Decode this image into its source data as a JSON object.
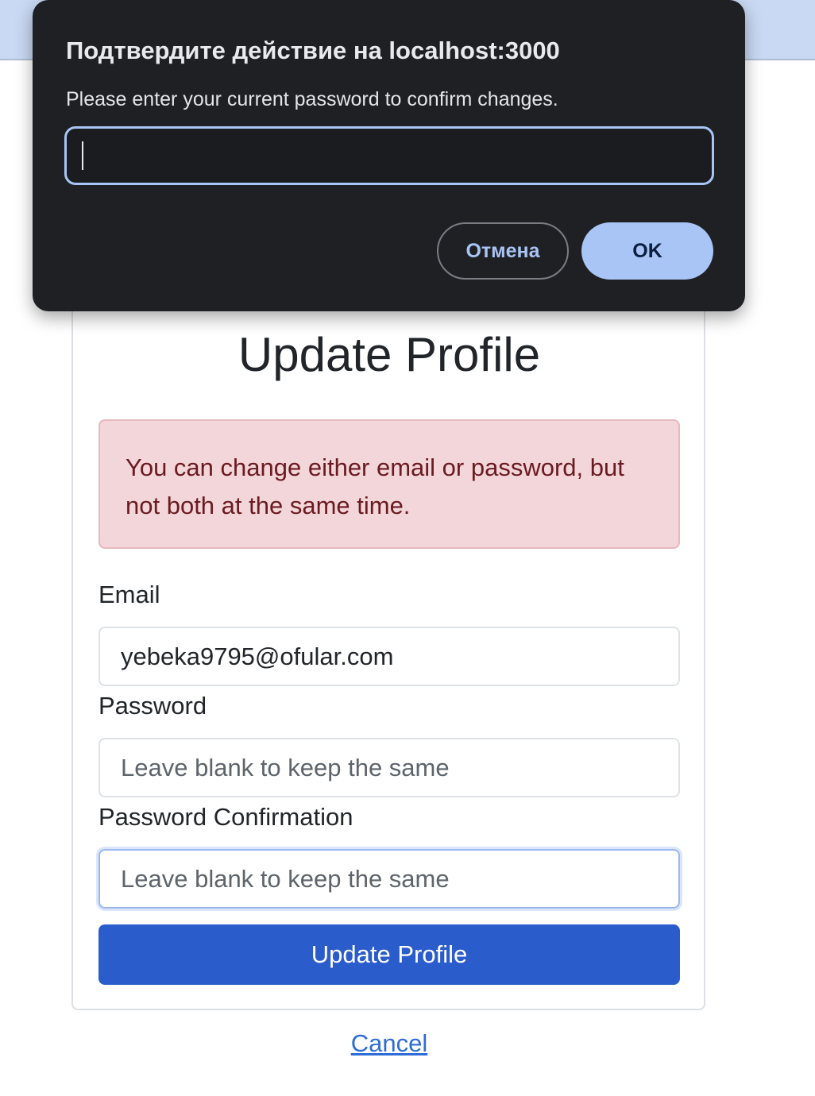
{
  "dialog": {
    "title": "Подтвердите действие на localhost:3000",
    "message": "Please enter your current password to confirm changes.",
    "input_value": "",
    "cancel_label": "Отмена",
    "ok_label": "OK"
  },
  "page": {
    "title": "Update Profile",
    "alert_text": "You can change either email or password, but not both at the same time.",
    "fields": {
      "email": {
        "label": "Email",
        "value": "yebeka9795@ofular.com"
      },
      "password": {
        "label": "Password",
        "placeholder": "Leave blank to keep the same"
      },
      "password_confirmation": {
        "label": "Password Confirmation",
        "placeholder": "Leave blank to keep the same"
      }
    },
    "submit_label": "Update Profile",
    "cancel_link": "Cancel"
  },
  "colors": {
    "primary": "#2b5ccc",
    "alert_bg": "#f3d6d9",
    "alert_text": "#6a1a21",
    "dialog_bg": "#1f2024",
    "dialog_accent": "#a9c5f5"
  }
}
